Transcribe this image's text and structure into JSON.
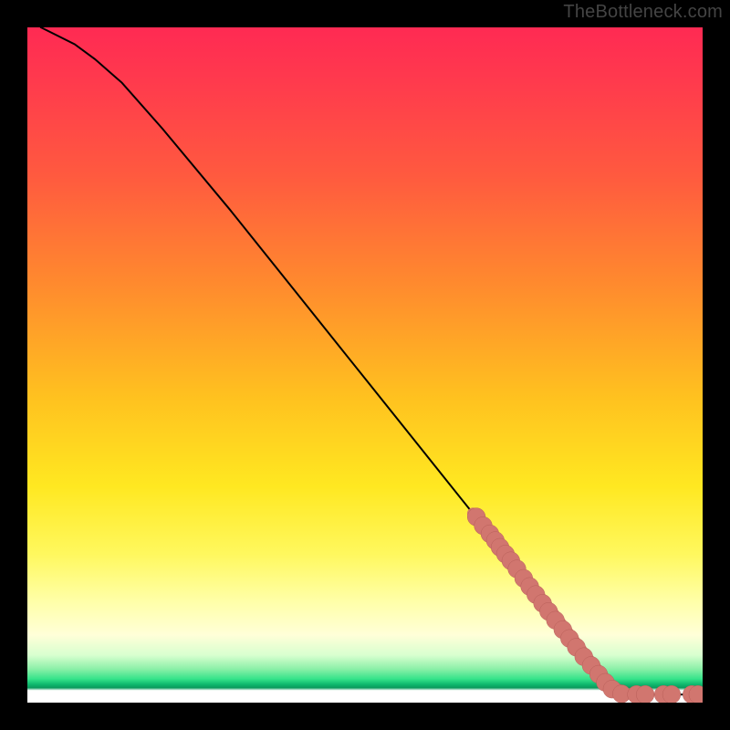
{
  "watermark": "TheBottleneck.com",
  "colors": {
    "curve": "#000000",
    "dot_fill": "#d1766f",
    "dot_stroke": "#b85f59",
    "background_black": "#000000"
  },
  "chart_data": {
    "type": "line",
    "title": "",
    "xlabel": "",
    "ylabel": "",
    "xlim": [
      0,
      100
    ],
    "ylim": [
      0,
      100
    ],
    "curve_points": [
      {
        "x": 2,
        "y": 100
      },
      {
        "x": 4,
        "y": 99
      },
      {
        "x": 7,
        "y": 97.5
      },
      {
        "x": 10,
        "y": 95.3
      },
      {
        "x": 14,
        "y": 91.8
      },
      {
        "x": 20,
        "y": 85
      },
      {
        "x": 30,
        "y": 73
      },
      {
        "x": 40,
        "y": 60.5
      },
      {
        "x": 50,
        "y": 48
      },
      {
        "x": 58,
        "y": 38
      },
      {
        "x": 66,
        "y": 28
      },
      {
        "x": 72,
        "y": 20.5
      },
      {
        "x": 78,
        "y": 13
      },
      {
        "x": 83,
        "y": 6.5
      },
      {
        "x": 86,
        "y": 3
      },
      {
        "x": 88,
        "y": 1.5
      },
      {
        "x": 90,
        "y": 1.2
      },
      {
        "x": 93,
        "y": 1.2
      },
      {
        "x": 96,
        "y": 1.2
      },
      {
        "x": 99,
        "y": 1.2
      }
    ],
    "dots": [
      {
        "x": 66.5,
        "y": 27.5,
        "r": 1.4
      },
      {
        "x": 67.5,
        "y": 26.2,
        "r": 1.4
      },
      {
        "x": 68.5,
        "y": 25.0,
        "r": 1.4
      },
      {
        "x": 69.3,
        "y": 24.0,
        "r": 1.4
      },
      {
        "x": 70.0,
        "y": 23.0,
        "r": 1.4
      },
      {
        "x": 70.8,
        "y": 22.0,
        "r": 1.4
      },
      {
        "x": 71.6,
        "y": 21.0,
        "r": 1.4
      },
      {
        "x": 72.5,
        "y": 19.8,
        "r": 1.4
      },
      {
        "x": 73.5,
        "y": 18.4,
        "r": 1.4
      },
      {
        "x": 74.4,
        "y": 17.2,
        "r": 1.4
      },
      {
        "x": 75.3,
        "y": 16.0,
        "r": 1.4
      },
      {
        "x": 76.3,
        "y": 14.7,
        "r": 1.4
      },
      {
        "x": 77.2,
        "y": 13.5,
        "r": 1.4
      },
      {
        "x": 78.2,
        "y": 12.2,
        "r": 1.4
      },
      {
        "x": 79.3,
        "y": 10.8,
        "r": 1.4
      },
      {
        "x": 80.3,
        "y": 9.5,
        "r": 1.4
      },
      {
        "x": 81.3,
        "y": 8.2,
        "r": 1.4
      },
      {
        "x": 82.4,
        "y": 6.8,
        "r": 1.4
      },
      {
        "x": 83.5,
        "y": 5.5,
        "r": 1.4
      },
      {
        "x": 84.6,
        "y": 4.2,
        "r": 1.4
      },
      {
        "x": 85.6,
        "y": 3.0,
        "r": 1.4
      },
      {
        "x": 86.6,
        "y": 2.0,
        "r": 1.4
      },
      {
        "x": 88.0,
        "y": 1.3,
        "r": 1.4
      },
      {
        "x": 90.2,
        "y": 1.2,
        "r": 1.4
      },
      {
        "x": 91.5,
        "y": 1.2,
        "r": 1.4
      },
      {
        "x": 94.2,
        "y": 1.2,
        "r": 1.4
      },
      {
        "x": 95.4,
        "y": 1.2,
        "r": 1.4
      },
      {
        "x": 98.4,
        "y": 1.2,
        "r": 1.4
      },
      {
        "x": 99.3,
        "y": 1.2,
        "r": 1.4
      }
    ],
    "curve_thick_segment": {
      "from_x": 66.5,
      "to_x": 88.0
    }
  }
}
